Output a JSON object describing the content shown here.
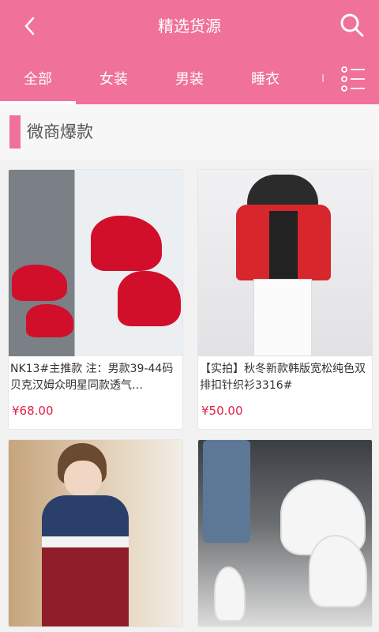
{
  "header": {
    "title": "精选货源"
  },
  "tabs": [
    {
      "label": "全部",
      "active": true
    },
    {
      "label": "女装",
      "active": false
    },
    {
      "label": "男装",
      "active": false
    },
    {
      "label": "睡衣",
      "active": false
    }
  ],
  "section": {
    "title": "微商爆款"
  },
  "products": [
    {
      "desc": "NK13#主推款 注：男款39-44码 贝克汉姆众明星同款透气…",
      "price": "¥68.00"
    },
    {
      "desc": "【实拍】秋冬新款韩版宽松纯色双排扣针织衫3316#",
      "price": "¥50.00"
    },
    {
      "desc": "",
      "price": ""
    },
    {
      "desc": "",
      "price": ""
    }
  ],
  "colors": {
    "accent": "#f07199",
    "price": "#e0244a"
  }
}
